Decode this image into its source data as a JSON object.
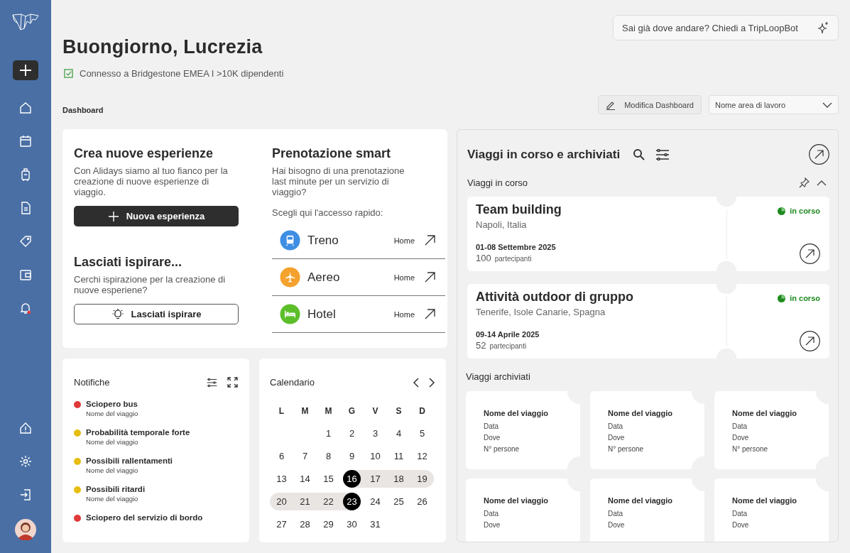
{
  "greeting": {
    "title": "Buongiorno, Lucrezia",
    "connection": "Connesso a Bridgestone EMEA I  >10K dipendenti",
    "connected": true
  },
  "assistant": {
    "placeholder": "Sai già dove andare? Chiedi a TripLoopBot"
  },
  "breadcrumb": "Dashboard",
  "toolbar": {
    "edit_button": "Modifica Dashboard",
    "workspace": {
      "value": "Nome area di lavoro"
    }
  },
  "create": {
    "title": "Crea nuove esperienze",
    "text": "Con Alidays siamo al tuo fianco per la creazione di nuove esperienze di viaggio.",
    "button": "Nuova esperienza"
  },
  "inspire": {
    "title": "Lasciati ispirare...",
    "text": "Cerchi ispirazione per la creazione di nuove esperiene?",
    "button": "Lasciati ispirare"
  },
  "smart": {
    "title": "Prenotazione smart",
    "text": "Hai bisogno di una prenotazione last minute per un servizio di viaggio?",
    "prompt": "Scegli qui l'accesso rapido:",
    "options": [
      {
        "kind": "train",
        "label": "Treno",
        "link": "Home",
        "color": "#3e8ee3"
      },
      {
        "kind": "plane",
        "label": "Aereo",
        "link": "Home",
        "color": "#f4a22d"
      },
      {
        "kind": "hotel",
        "label": "Hotel",
        "link": "Home",
        "color": "#5cbf2a"
      }
    ]
  },
  "notifications": {
    "title": "Notifiche",
    "items": [
      {
        "title": "Sciopero bus",
        "trip": "Nome del viaggio",
        "color": "#e03a3a"
      },
      {
        "title": "Probabilità temporale forte",
        "trip": "Nome del viaggio",
        "color": "#e6bd12"
      },
      {
        "title": "Possibili rallentamenti",
        "trip": "Nome del viaggio",
        "color": "#e6bd12"
      },
      {
        "title": "Possibili ritardi",
        "trip": "Nome del viaggio",
        "color": "#e6bd12"
      },
      {
        "title": "Sciopero del servizio di bordo",
        "color": "#e03a3a"
      }
    ]
  },
  "calendar": {
    "title": "Calendario",
    "weekdays": [
      "L",
      "M",
      "M",
      "G",
      "V",
      "S",
      "D"
    ],
    "weeks": [
      [
        {
          "day": "1",
          "selected": false,
          "in_range": false
        },
        {
          "day": "2",
          "selected": false,
          "in_range": false
        },
        {
          "day": "3",
          "selected": false,
          "in_range": false
        },
        {
          "day": "4",
          "selected": false,
          "in_range": false
        },
        {
          "day": "5",
          "selected": false,
          "in_range": false
        }
      ],
      [
        {
          "day": "6",
          "selected": false,
          "in_range": false
        },
        {
          "day": "7",
          "selected": false,
          "in_range": false
        },
        {
          "day": "8",
          "selected": false,
          "in_range": false
        },
        {
          "day": "9",
          "selected": false,
          "in_range": false
        },
        {
          "day": "10",
          "selected": false,
          "in_range": false
        },
        {
          "day": "11",
          "selected": false,
          "in_range": false
        },
        {
          "day": "12",
          "selected": false,
          "in_range": false
        }
      ],
      [
        {
          "day": "13",
          "selected": false,
          "in_range": false
        },
        {
          "day": "14",
          "selected": false,
          "in_range": false
        },
        {
          "day": "15",
          "selected": false,
          "in_range": false
        },
        {
          "day": "16",
          "selected": true,
          "in_range": false
        },
        {
          "day": "17",
          "selected": false,
          "in_range": true
        },
        {
          "day": "18",
          "selected": false,
          "in_range": true
        },
        {
          "day": "19",
          "selected": false,
          "in_range": true
        }
      ],
      [
        {
          "day": "20",
          "selected": false,
          "in_range": true
        },
        {
          "day": "21",
          "selected": false,
          "in_range": true
        },
        {
          "day": "22",
          "selected": false,
          "in_range": true
        },
        {
          "day": "23",
          "selected": true,
          "in_range": false
        },
        {
          "day": "24",
          "selected": false,
          "in_range": false
        },
        {
          "day": "25",
          "selected": false,
          "in_range": false
        },
        {
          "day": "26",
          "selected": false,
          "in_range": false
        }
      ],
      [
        {
          "day": "27",
          "selected": false,
          "in_range": false
        },
        {
          "day": "28",
          "selected": false,
          "in_range": false
        },
        {
          "day": "29",
          "selected": false,
          "in_range": false
        },
        {
          "day": "30",
          "selected": false,
          "in_range": false
        },
        {
          "day": "31",
          "selected": false,
          "in_range": false
        }
      ]
    ]
  },
  "trips": {
    "title": "Viaggi in corso e archiviati",
    "ongoing": {
      "title": "Viaggi in corso",
      "expanded": true,
      "trips": [
        {
          "name": "Team building",
          "place": "Napoli, Italia",
          "dates": "01-08 Settembre 2025",
          "count": "100",
          "count_label": "partecipanti",
          "status": "in corso"
        },
        {
          "name": "Attività outdoor di gruppo",
          "place": "Tenerife, Isole Canarie, Spagna",
          "dates": "09-14 Aprile 2025",
          "count": "52",
          "count_label": "partecipanti",
          "status": "in corso"
        }
      ]
    },
    "archived": {
      "title": "Viaggi archiviati",
      "trips": [
        {
          "name": "Nome del viaggio",
          "date": "Data",
          "place": "Dove",
          "people": "N° persone"
        },
        {
          "name": "Nome del viaggio",
          "date": "Data",
          "place": "Dove",
          "people": "N° persone"
        },
        {
          "name": "Nome del viaggio",
          "date": "Data",
          "place": "Dove",
          "people": "N° persone"
        },
        {
          "name": "Nome del viaggio",
          "date": "Data",
          "place": "Dove"
        },
        {
          "name": "Nome del viaggio",
          "date": "Data",
          "place": "Dove"
        },
        {
          "name": "Nome del viaggio",
          "date": "Data",
          "place": "Dove"
        }
      ]
    }
  }
}
